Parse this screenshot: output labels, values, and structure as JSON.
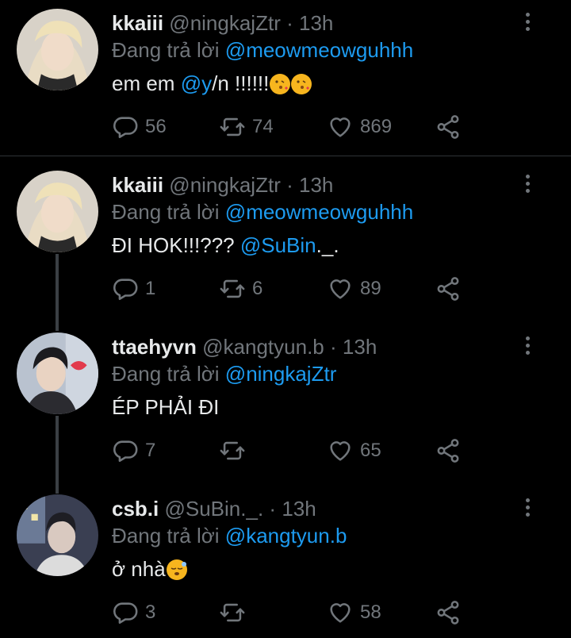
{
  "colors": {
    "background": "#000000",
    "link": "#1d9bf0",
    "muted": "#71767b",
    "text": "#e7e9ea"
  },
  "tweets": [
    {
      "display_name": "kkaiii",
      "handle": "@ningkajZtr",
      "sep": "·",
      "time": "13h",
      "reply_prefix": "Đang trả lời",
      "reply_to": "@meowmeowguhhh",
      "body_pre": "em em",
      "body_mention": "@y",
      "body_post": "/n !!!!!!",
      "emoji": [
        "face-blowing-kiss",
        "face-blowing-kiss"
      ],
      "replies": "56",
      "retweets": "74",
      "likes": "869"
    },
    {
      "display_name": "kkaiii",
      "handle": "@ningkajZtr",
      "sep": "·",
      "time": "13h",
      "reply_prefix": "Đang trả lời",
      "reply_to": "@meowmeowguhhh",
      "body_pre": "ĐI HOK!!!???",
      "body_mention": "@SuBin",
      "body_post": "._.",
      "replies": "1",
      "retweets": "6",
      "likes": "89"
    },
    {
      "display_name": "ttaehyvn",
      "handle": "@kangtyun.b",
      "sep": "·",
      "time": "13h",
      "reply_prefix": "Đang trả lời",
      "reply_to": "@ningkajZtr",
      "body_pre": "ÉP PHẢI ĐI",
      "replies": "7",
      "retweets": "",
      "likes": "65"
    },
    {
      "display_name": "csb.i",
      "handle": "@SuBin._.",
      "sep": "·",
      "time": "13h",
      "reply_prefix": "Đang trả lời",
      "reply_to": "@kangtyun.b",
      "body_pre": "ở nhà",
      "emoji": [
        "sleeping-face"
      ],
      "replies": "3",
      "retweets": "",
      "likes": "58"
    }
  ]
}
